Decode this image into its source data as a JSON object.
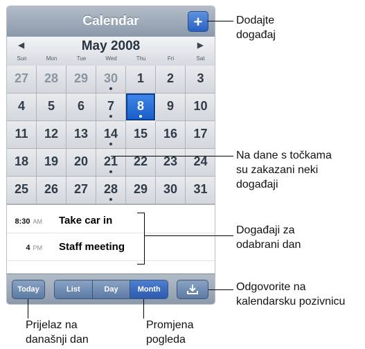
{
  "app": {
    "title": "Calendar",
    "add_label": "+"
  },
  "month_bar": {
    "title": "May 2008",
    "prev_arrow": "◀",
    "next_arrow": "▶",
    "weekdays": [
      "Sun",
      "Mon",
      "Tue",
      "Wed",
      "Thu",
      "Fri",
      "Sat"
    ]
  },
  "calendar": {
    "weeks": [
      [
        {
          "day": "27",
          "other": true
        },
        {
          "day": "28",
          "other": true
        },
        {
          "day": "29",
          "other": true
        },
        {
          "day": "30",
          "other": true,
          "dot": true
        },
        {
          "day": "1"
        },
        {
          "day": "2"
        },
        {
          "day": "3"
        }
      ],
      [
        {
          "day": "4"
        },
        {
          "day": "5"
        },
        {
          "day": "6"
        },
        {
          "day": "7",
          "dot": true
        },
        {
          "day": "8",
          "selected": true,
          "dot": true
        },
        {
          "day": "9"
        },
        {
          "day": "10"
        }
      ],
      [
        {
          "day": "11"
        },
        {
          "day": "12"
        },
        {
          "day": "13"
        },
        {
          "day": "14",
          "dot": true
        },
        {
          "day": "15"
        },
        {
          "day": "16"
        },
        {
          "day": "17"
        }
      ],
      [
        {
          "day": "18"
        },
        {
          "day": "19"
        },
        {
          "day": "20"
        },
        {
          "day": "21",
          "dot": true
        },
        {
          "day": "22"
        },
        {
          "day": "23"
        },
        {
          "day": "24"
        }
      ],
      [
        {
          "day": "25"
        },
        {
          "day": "26"
        },
        {
          "day": "27"
        },
        {
          "day": "28",
          "dot": true
        },
        {
          "day": "29"
        },
        {
          "day": "30"
        },
        {
          "day": "31"
        }
      ]
    ]
  },
  "events": [
    {
      "time": "8:30",
      "ampm": "AM",
      "title": "Take car in"
    },
    {
      "time": "4",
      "ampm": "PM",
      "title": "Staff meeting"
    }
  ],
  "toolbar": {
    "today_label": "Today",
    "views": [
      {
        "label": "List",
        "active": false
      },
      {
        "label": "Day",
        "active": false
      },
      {
        "label": "Month",
        "active": true
      }
    ],
    "invite_icon": "download-tray-icon"
  },
  "callouts": {
    "add_event": "Dodajte\ndogađaj",
    "dots": "Na dane s točkama\nsu zakazani neki\ndogađaji",
    "events": "Događaji za\nodabrani dan",
    "invites": "Odgovorite na\nkalendarsku pozivnicu",
    "today": "Prijelaz na\ndanašnji dan",
    "views": "Promjena\npogleda"
  }
}
